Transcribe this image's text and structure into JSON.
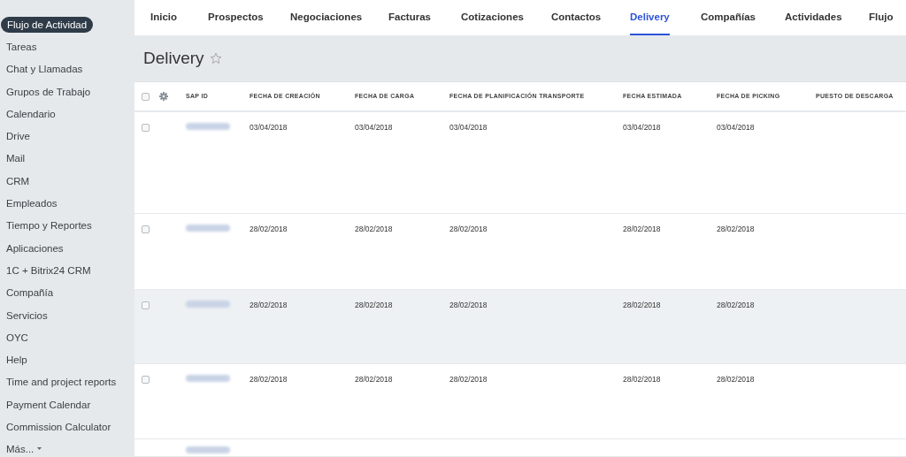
{
  "sidebar": {
    "items": [
      {
        "label": "Flujo de Actividad",
        "selected": true
      },
      {
        "label": "Tareas",
        "selected": false
      },
      {
        "label": "Chat y Llamadas",
        "selected": false
      },
      {
        "label": "Grupos de Trabajo",
        "selected": false
      },
      {
        "label": "Calendario",
        "selected": false
      },
      {
        "label": "Drive",
        "selected": false
      },
      {
        "label": "Mail",
        "selected": false
      },
      {
        "label": "CRM",
        "selected": false
      },
      {
        "label": "Empleados",
        "selected": false
      },
      {
        "label": "Tiempo y Reportes",
        "selected": false
      },
      {
        "label": "Aplicaciones",
        "selected": false
      },
      {
        "label": "1C + Bitrix24 CRM",
        "selected": false
      },
      {
        "label": "Compañía",
        "selected": false
      },
      {
        "label": "Servicios",
        "selected": false
      },
      {
        "label": "OYC",
        "selected": false
      },
      {
        "label": "Help",
        "selected": false
      },
      {
        "label": "Time and project reports",
        "selected": false
      },
      {
        "label": "Payment Calendar",
        "selected": false
      },
      {
        "label": "Commission Calculator",
        "selected": false
      }
    ],
    "more": "Más..."
  },
  "tabs": [
    {
      "label": "Inicio",
      "selected": false
    },
    {
      "label": "Prospectos",
      "selected": false
    },
    {
      "label": "Negociaciones",
      "selected": false
    },
    {
      "label": "Facturas",
      "selected": false
    },
    {
      "label": "Cotizaciones",
      "selected": false
    },
    {
      "label": "Contactos",
      "selected": false
    },
    {
      "label": "Delivery",
      "selected": true
    },
    {
      "label": "Compañías",
      "selected": false
    },
    {
      "label": "Actividades",
      "selected": false
    },
    {
      "label": "Flujo",
      "selected": false
    }
  ],
  "page_title": "Delivery",
  "table": {
    "select_all_checked": false,
    "columns": [
      "SAP ID",
      "FECHA DE CREACIÓN",
      "FECHA DE CARGA",
      "FECHA DE PLANIFICACIÓN TRANSPORTE",
      "FECHA ESTIMADA",
      "FECHA DE PICKING",
      "PUESTO DE DESCARGA"
    ],
    "rows": [
      {
        "checked": false,
        "highlighted": false,
        "cells": [
          "",
          "03/04/2018",
          "03/04/2018",
          "03/04/2018",
          "03/04/2018",
          "03/04/2018"
        ]
      },
      {
        "checked": false,
        "highlighted": false,
        "cells": [
          "",
          "28/02/2018",
          "28/02/2018",
          "28/02/2018",
          "28/02/2018",
          "28/02/2018"
        ]
      },
      {
        "checked": false,
        "highlighted": true,
        "cells": [
          "",
          "28/02/2018",
          "28/02/2018",
          "28/02/2018",
          "28/02/2018",
          "28/02/2018"
        ]
      },
      {
        "checked": false,
        "highlighted": false,
        "cells": [
          "",
          "28/02/2018",
          "28/02/2018",
          "28/02/2018",
          "28/02/2018",
          "28/02/2018"
        ]
      }
    ]
  }
}
